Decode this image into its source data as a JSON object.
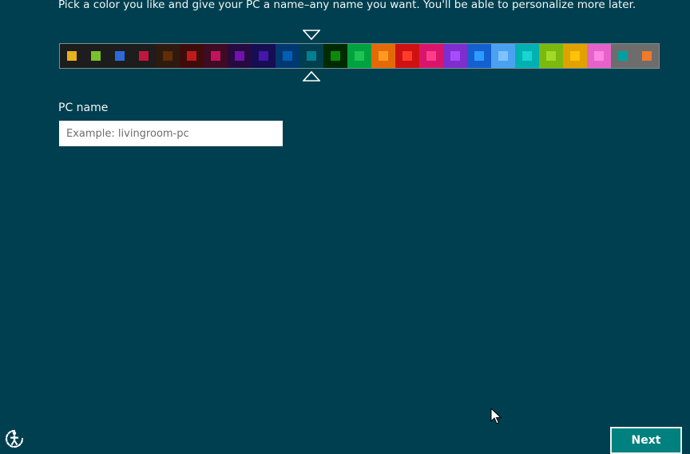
{
  "instruction": "Pick a color you like and give your PC a name–any name you want. You'll be able to personalize more later.",
  "palette": {
    "selected_index": 10,
    "swatches": [
      {
        "bg": "#1d1d1d",
        "chip": "#e8b11e"
      },
      {
        "bg": "#1d1d1d",
        "chip": "#7cbf2c"
      },
      {
        "bg": "#1d1d1d",
        "chip": "#2d6ad8"
      },
      {
        "bg": "#1d1d1d",
        "chip": "#c0163f"
      },
      {
        "bg": "#2e1b0e",
        "chip": "#612e07"
      },
      {
        "bg": "#3f0c0c",
        "chip": "#bf1b1b"
      },
      {
        "bg": "#3f0a23",
        "chip": "#c2145a"
      },
      {
        "bg": "#270a3f",
        "chip": "#7013ae"
      },
      {
        "bg": "#160e52",
        "chip": "#4615ab"
      },
      {
        "bg": "#003871",
        "chip": "#0060b6"
      },
      {
        "bg": "#003f4f",
        "chip": "#008090"
      },
      {
        "bg": "#002b00",
        "chip": "#0b8a0b"
      },
      {
        "bg": "#00a23f",
        "chip": "#1dc450"
      },
      {
        "bg": "#e36a07",
        "chip": "#ff9a21"
      },
      {
        "bg": "#cf1111",
        "chip": "#ff3c2c"
      },
      {
        "bg": "#d7166b",
        "chip": "#ff3d8c"
      },
      {
        "bg": "#7d2ecc",
        "chip": "#a64cff"
      },
      {
        "bg": "#1460d0",
        "chip": "#2d9cff"
      },
      {
        "bg": "#4aa1f1",
        "chip": "#7fc2ff"
      },
      {
        "bg": "#00b1b1",
        "chip": "#1ad3d3"
      },
      {
        "bg": "#7cb90f",
        "chip": "#a1db26"
      },
      {
        "bg": "#e1a200",
        "chip": "#ffc206"
      },
      {
        "bg": "#e563c9",
        "chip": "#ff86e3"
      },
      {
        "bg": "#6d6d6d",
        "chip": "#00a0a0"
      },
      {
        "bg": "#6d6d6d",
        "chip": "#f07a2a"
      }
    ]
  },
  "pc_name": {
    "label": "PC name",
    "value": "",
    "placeholder": "Example: livingroom-pc"
  },
  "footer": {
    "next_label": "Next",
    "ease_of_access_icon": "ease-of-access-icon"
  },
  "colors": {
    "background": "#003f4f",
    "accent": "#00807f",
    "marker": "#ffffff"
  }
}
